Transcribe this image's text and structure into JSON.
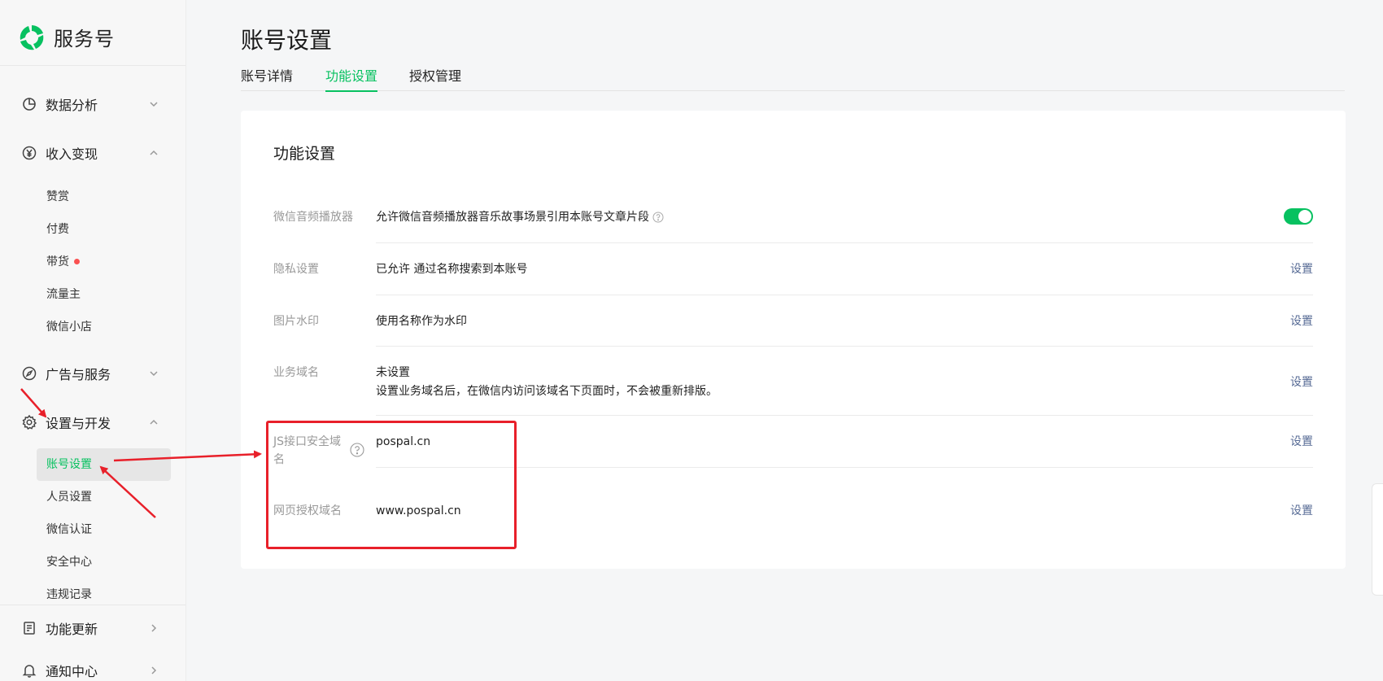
{
  "app": {
    "name": "服务号"
  },
  "sidebar": {
    "groups": [
      {
        "label": "数据分析",
        "icon": "pie-chart-icon",
        "expanded": false
      },
      {
        "label": "收入变现",
        "icon": "yen-icon",
        "expanded": true,
        "items": [
          {
            "label": "赞赏"
          },
          {
            "label": "付费"
          },
          {
            "label": "带货",
            "badge": "red-dot"
          },
          {
            "label": "流量主"
          },
          {
            "label": "微信小店"
          }
        ]
      },
      {
        "label": "广告与服务",
        "icon": "compass-icon",
        "expanded": false
      },
      {
        "label": "设置与开发",
        "icon": "gear-icon",
        "expanded": true,
        "items": [
          {
            "label": "账号设置",
            "active": true
          },
          {
            "label": "人员设置"
          },
          {
            "label": "微信认证"
          },
          {
            "label": "安全中心"
          },
          {
            "label": "违规记录"
          }
        ]
      },
      {
        "label": "功能更新",
        "icon": "update-doc-icon",
        "expanded": false
      },
      {
        "label": "通知中心",
        "icon": "bell-icon",
        "expanded": false
      }
    ]
  },
  "page": {
    "title": "账号设置",
    "tabs": [
      {
        "label": "账号详情",
        "active": false
      },
      {
        "label": "功能设置",
        "active": true
      },
      {
        "label": "授权管理",
        "active": false
      }
    ]
  },
  "card": {
    "title": "功能设置",
    "rows": [
      {
        "label": "微信音频播放器",
        "value": "允许微信音频播放器音乐故事场景引用本账号文章片段",
        "toggle_on": true
      },
      {
        "label": "隐私设置",
        "value": "已允许 通过名称搜索到本账号",
        "action": "设置"
      },
      {
        "label": "图片水印",
        "value": "使用名称作为水印",
        "action": "设置"
      },
      {
        "label": "业务域名",
        "value": "未设置",
        "sub": "设置业务域名后，在微信内访问该域名下页面时，不会被重新排版。",
        "action": "设置"
      },
      {
        "label_line1": "JS接口安全域",
        "label_line2": "名",
        "value": "pospal.cn",
        "action": "设置"
      },
      {
        "label": "网页授权域名",
        "value": "www.pospal.cn",
        "action": "设置"
      }
    ]
  },
  "colors": {
    "brand": "#07c160",
    "link": "#576b95",
    "annotation": "#e8202a",
    "badge": "#fa5151"
  }
}
